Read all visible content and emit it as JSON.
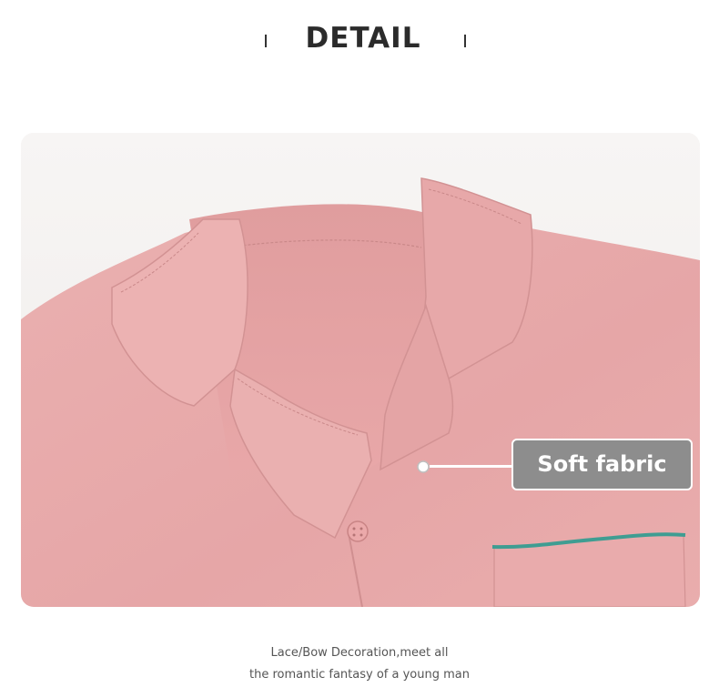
{
  "header": {
    "title": "DETAIL"
  },
  "callout": {
    "label": "Soft fabric"
  },
  "caption": {
    "line1": "Lace/Bow Decoration,meet all",
    "line2": "the romantic fantasy of a young man"
  },
  "colors": {
    "fabric": "#e8a9a9",
    "fabric_shadow": "#d99797",
    "piping": "#3f9d92",
    "callout_box": "#8d8d8d"
  }
}
